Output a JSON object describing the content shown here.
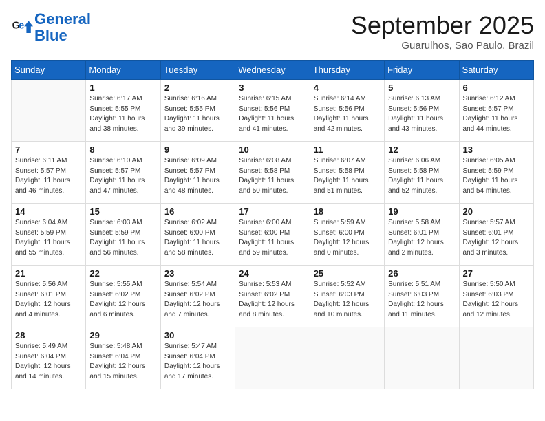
{
  "header": {
    "logo_line1": "General",
    "logo_line2": "Blue",
    "month": "September 2025",
    "location": "Guarulhos, Sao Paulo, Brazil"
  },
  "weekdays": [
    "Sunday",
    "Monday",
    "Tuesday",
    "Wednesday",
    "Thursday",
    "Friday",
    "Saturday"
  ],
  "weeks": [
    [
      {
        "day": "",
        "info": ""
      },
      {
        "day": "1",
        "info": "Sunrise: 6:17 AM\nSunset: 5:55 PM\nDaylight: 11 hours\nand 38 minutes."
      },
      {
        "day": "2",
        "info": "Sunrise: 6:16 AM\nSunset: 5:55 PM\nDaylight: 11 hours\nand 39 minutes."
      },
      {
        "day": "3",
        "info": "Sunrise: 6:15 AM\nSunset: 5:56 PM\nDaylight: 11 hours\nand 41 minutes."
      },
      {
        "day": "4",
        "info": "Sunrise: 6:14 AM\nSunset: 5:56 PM\nDaylight: 11 hours\nand 42 minutes."
      },
      {
        "day": "5",
        "info": "Sunrise: 6:13 AM\nSunset: 5:56 PM\nDaylight: 11 hours\nand 43 minutes."
      },
      {
        "day": "6",
        "info": "Sunrise: 6:12 AM\nSunset: 5:57 PM\nDaylight: 11 hours\nand 44 minutes."
      }
    ],
    [
      {
        "day": "7",
        "info": "Sunrise: 6:11 AM\nSunset: 5:57 PM\nDaylight: 11 hours\nand 46 minutes."
      },
      {
        "day": "8",
        "info": "Sunrise: 6:10 AM\nSunset: 5:57 PM\nDaylight: 11 hours\nand 47 minutes."
      },
      {
        "day": "9",
        "info": "Sunrise: 6:09 AM\nSunset: 5:57 PM\nDaylight: 11 hours\nand 48 minutes."
      },
      {
        "day": "10",
        "info": "Sunrise: 6:08 AM\nSunset: 5:58 PM\nDaylight: 11 hours\nand 50 minutes."
      },
      {
        "day": "11",
        "info": "Sunrise: 6:07 AM\nSunset: 5:58 PM\nDaylight: 11 hours\nand 51 minutes."
      },
      {
        "day": "12",
        "info": "Sunrise: 6:06 AM\nSunset: 5:58 PM\nDaylight: 11 hours\nand 52 minutes."
      },
      {
        "day": "13",
        "info": "Sunrise: 6:05 AM\nSunset: 5:59 PM\nDaylight: 11 hours\nand 54 minutes."
      }
    ],
    [
      {
        "day": "14",
        "info": "Sunrise: 6:04 AM\nSunset: 5:59 PM\nDaylight: 11 hours\nand 55 minutes."
      },
      {
        "day": "15",
        "info": "Sunrise: 6:03 AM\nSunset: 5:59 PM\nDaylight: 11 hours\nand 56 minutes."
      },
      {
        "day": "16",
        "info": "Sunrise: 6:02 AM\nSunset: 6:00 PM\nDaylight: 11 hours\nand 58 minutes."
      },
      {
        "day": "17",
        "info": "Sunrise: 6:00 AM\nSunset: 6:00 PM\nDaylight: 11 hours\nand 59 minutes."
      },
      {
        "day": "18",
        "info": "Sunrise: 5:59 AM\nSunset: 6:00 PM\nDaylight: 12 hours\nand 0 minutes."
      },
      {
        "day": "19",
        "info": "Sunrise: 5:58 AM\nSunset: 6:01 PM\nDaylight: 12 hours\nand 2 minutes."
      },
      {
        "day": "20",
        "info": "Sunrise: 5:57 AM\nSunset: 6:01 PM\nDaylight: 12 hours\nand 3 minutes."
      }
    ],
    [
      {
        "day": "21",
        "info": "Sunrise: 5:56 AM\nSunset: 6:01 PM\nDaylight: 12 hours\nand 4 minutes."
      },
      {
        "day": "22",
        "info": "Sunrise: 5:55 AM\nSunset: 6:02 PM\nDaylight: 12 hours\nand 6 minutes."
      },
      {
        "day": "23",
        "info": "Sunrise: 5:54 AM\nSunset: 6:02 PM\nDaylight: 12 hours\nand 7 minutes."
      },
      {
        "day": "24",
        "info": "Sunrise: 5:53 AM\nSunset: 6:02 PM\nDaylight: 12 hours\nand 8 minutes."
      },
      {
        "day": "25",
        "info": "Sunrise: 5:52 AM\nSunset: 6:03 PM\nDaylight: 12 hours\nand 10 minutes."
      },
      {
        "day": "26",
        "info": "Sunrise: 5:51 AM\nSunset: 6:03 PM\nDaylight: 12 hours\nand 11 minutes."
      },
      {
        "day": "27",
        "info": "Sunrise: 5:50 AM\nSunset: 6:03 PM\nDaylight: 12 hours\nand 12 minutes."
      }
    ],
    [
      {
        "day": "28",
        "info": "Sunrise: 5:49 AM\nSunset: 6:04 PM\nDaylight: 12 hours\nand 14 minutes."
      },
      {
        "day": "29",
        "info": "Sunrise: 5:48 AM\nSunset: 6:04 PM\nDaylight: 12 hours\nand 15 minutes."
      },
      {
        "day": "30",
        "info": "Sunrise: 5:47 AM\nSunset: 6:04 PM\nDaylight: 12 hours\nand 17 minutes."
      },
      {
        "day": "",
        "info": ""
      },
      {
        "day": "",
        "info": ""
      },
      {
        "day": "",
        "info": ""
      },
      {
        "day": "",
        "info": ""
      }
    ]
  ]
}
